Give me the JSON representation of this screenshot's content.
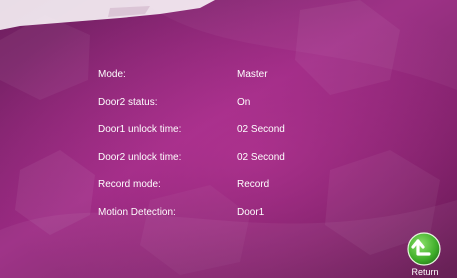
{
  "settings": [
    {
      "label": "Mode:",
      "value": "Master"
    },
    {
      "label": "Door2 status:",
      "value": "On"
    },
    {
      "label": "Door1 unlock time:",
      "value": "02 Second"
    },
    {
      "label": "Door2 unlock time:",
      "value": "02 Second"
    },
    {
      "label": "Record mode:",
      "value": "Record"
    },
    {
      "label": "Motion Detection:",
      "value": "Door1"
    }
  ],
  "return_button": {
    "label": "Return",
    "icon": "return-arrow-icon",
    "color": "#3fae2a"
  },
  "theme": {
    "background": "#8a1f6e",
    "accent": "#c23aa0",
    "text": "#ffffff"
  }
}
